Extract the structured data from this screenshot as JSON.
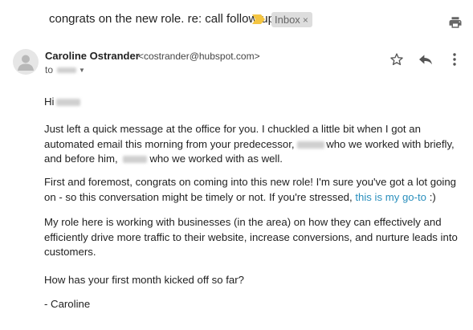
{
  "thread": {
    "subject": "congrats on the new role. re: call follow-up",
    "label": "Inbox",
    "label_remove": "×"
  },
  "message": {
    "sender_name": "Caroline Ostrander",
    "sender_email": "<costrander@hubspot.com>",
    "to_label": "to"
  },
  "body": {
    "greeting": "Hi",
    "p1_a": "Just left a quick message at the office for you. I chuckled a little bit when I got an automated email this morning from your predecessor,",
    "p1_b": "who we worked with briefly, and before him,",
    "p1_c": "who we worked with as well.",
    "p2_a": "First and foremost, congrats on coming into this new role! I'm sure you've got a lot going on - so this conversation might be timely or not. If you're stressed,",
    "p2_link": "this is my go-to",
    "p2_b": ":)",
    "p3": "My role here is working with businesses (in the area) on how they can effectively and efficiently drive more traffic to their website, increase conversions, and nurture leads into customers.",
    "p4": "How has your first month kicked off so far?",
    "signoff": "- Caroline"
  },
  "icons": {
    "importance": "importance-marker-icon",
    "print": "print-icon",
    "avatar": "default-avatar-icon",
    "star": "star-icon",
    "reply": "reply-icon",
    "more": "more-vert-icon",
    "caret": "chevron-down-icon"
  },
  "colors": {
    "importance": "#f4c542",
    "link": "#2a8fbd",
    "label_bg": "#dddddd"
  }
}
